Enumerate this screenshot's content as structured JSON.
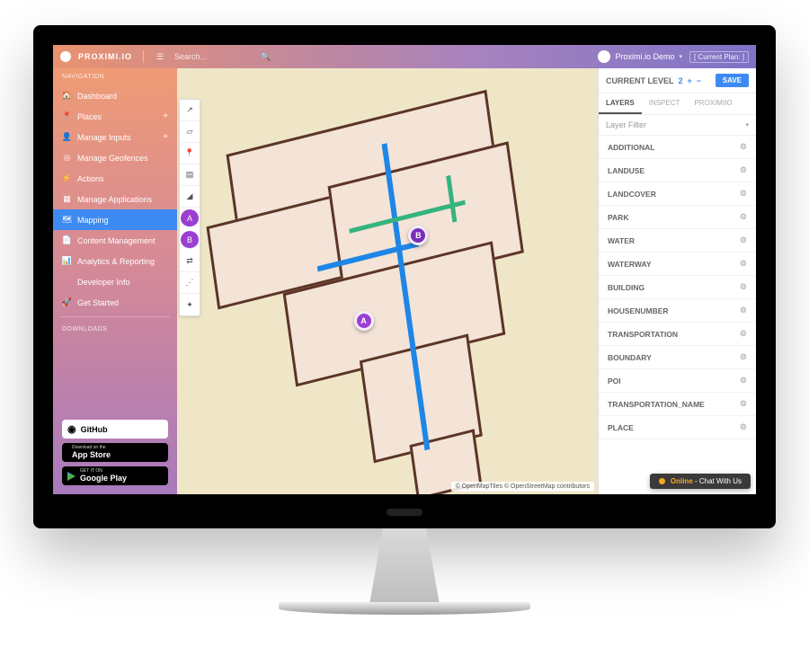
{
  "header": {
    "brand": "PROXIMI.IO",
    "search_placeholder": "Search...",
    "user_name": "Proximi.io Demo",
    "plan_label": "[ Current Plan: ]"
  },
  "sidebar": {
    "section_nav": "NAVIGATION",
    "section_downloads": "DOWNLOADS",
    "items": [
      {
        "label": "Dashboard",
        "icon": "speedometer",
        "plus": false
      },
      {
        "label": "Places",
        "icon": "pin",
        "plus": true
      },
      {
        "label": "Manage Inputs",
        "icon": "person",
        "plus": true
      },
      {
        "label": "Manage Geofences",
        "icon": "target",
        "plus": false
      },
      {
        "label": "Actions",
        "icon": "bolt",
        "plus": false
      },
      {
        "label": "Manage Applications",
        "icon": "grid",
        "plus": false
      },
      {
        "label": "Mapping",
        "icon": "map",
        "plus": false,
        "active": true
      },
      {
        "label": "Content Management",
        "icon": "doc",
        "plus": false
      },
      {
        "label": "Analytics & Reporting",
        "icon": "chart",
        "plus": false
      },
      {
        "label": "Developer Info",
        "icon": "code",
        "plus": false
      },
      {
        "label": "Get Started",
        "icon": "launch",
        "plus": false
      }
    ],
    "downloads": {
      "github": "GitHub",
      "appstore_small": "Download on the",
      "appstore_big": "App Store",
      "gplay_small": "GET IT ON",
      "gplay_big": "Google Play"
    }
  },
  "map": {
    "markers": {
      "a": "A",
      "b": "B"
    },
    "attribution": "© OpenMapTiles © OpenStreetMap contributors",
    "tools": [
      "line",
      "polygon",
      "marker",
      "levels",
      "gradient",
      "a",
      "b",
      "route",
      "path",
      "sparkle"
    ]
  },
  "right": {
    "level_label": "CURRENT LEVEL",
    "level_value": "2",
    "plus": "+",
    "minus": "−",
    "save": "SAVE",
    "tabs": [
      "LAYERS",
      "INSPECT",
      "PROXIMIIO"
    ],
    "active_tab": 0,
    "filter_label": "Layer Filter",
    "layers": [
      "ADDITIONAL",
      "LANDUSE",
      "LANDCOVER",
      "PARK",
      "WATER",
      "WATERWAY",
      "BUILDING",
      "HOUSENUMBER",
      "TRANSPORTATION",
      "BOUNDARY",
      "POI",
      "TRANSPORTATION_NAME",
      "PLACE"
    ]
  },
  "chat": {
    "status": "Online",
    "text": " - Chat With Us"
  }
}
